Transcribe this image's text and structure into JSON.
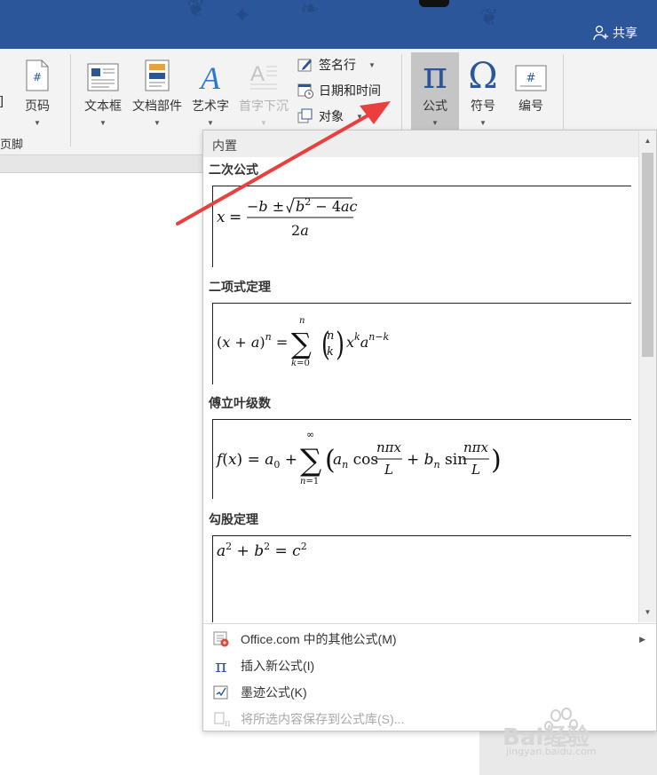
{
  "titlebar": {
    "share_label": "共享"
  },
  "ribbon": {
    "buttons": {
      "page_number": "页码",
      "textbox": "文本框",
      "quick_parts": "文档部件",
      "wordart": "艺术字",
      "drop_cap": "首字下沉",
      "equation": "公式",
      "symbol": "符号",
      "numbering": "编号"
    },
    "small": {
      "signature_line": "签名行",
      "date_time": "日期和时间",
      "object": "对象"
    },
    "partial_left_label": "]",
    "group_label_header_footer": "页脚"
  },
  "gallery": {
    "section": "内置",
    "items": [
      {
        "title": "二次公式"
      },
      {
        "title": "二项式定理"
      },
      {
        "title": "傅立叶级数"
      },
      {
        "title": "勾股定理"
      }
    ]
  },
  "menu": {
    "items": [
      {
        "label": "Office.com 中的其他公式(M)",
        "enabled": true
      },
      {
        "label": "插入新公式(I)",
        "enabled": true
      },
      {
        "label": "墨迹公式(K)",
        "enabled": true
      },
      {
        "label": "将所选内容保存到公式库(S)...",
        "enabled": false
      }
    ]
  },
  "watermark": {
    "brand": "Bai经验",
    "url": "jingyan.baidu.com"
  },
  "colors": {
    "titlebar": "#2b579a",
    "accent_blue": "#2b579a",
    "annotation_arrow": "#ea3f3f",
    "selected_button": "#c5c5c5"
  }
}
